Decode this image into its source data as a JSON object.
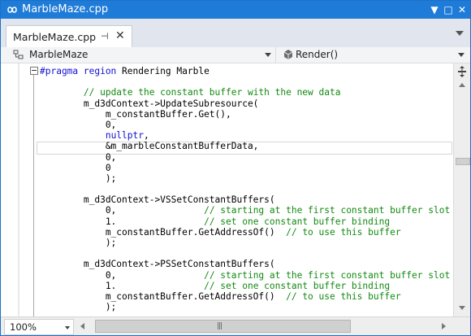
{
  "window": {
    "title": "MarbleMaze.cpp",
    "title_icon": "infinity-icon",
    "accent_color": "#1f7bd8"
  },
  "titlebar_buttons": [
    {
      "name": "dropdown-icon",
      "glyph": "▼"
    },
    {
      "name": "maximize-icon",
      "glyph": "□"
    },
    {
      "name": "close-icon",
      "glyph": "✕"
    }
  ],
  "tab": {
    "label": "MarbleMaze.cpp",
    "pin_glyph": "⊣",
    "close_glyph": "✕"
  },
  "navbar": {
    "left": {
      "label": "MarbleMaze",
      "icon": "class-icon"
    },
    "right": {
      "label": "Render()",
      "icon": "method-icon"
    }
  },
  "code_lines": [
    [
      {
        "t": "#pragma region",
        "c": "kw"
      },
      {
        "t": " Rendering Marble",
        "c": ""
      }
    ],
    [],
    [
      {
        "t": "        ",
        "c": ""
      },
      {
        "t": "// update the constant buffer with the new data",
        "c": "cm"
      }
    ],
    [
      {
        "t": "        m_d3dContext->UpdateSubresource(",
        "c": ""
      }
    ],
    [
      {
        "t": "            m_constantBuffer.Get(),",
        "c": ""
      }
    ],
    [
      {
        "t": "            0,",
        "c": ""
      }
    ],
    [
      {
        "t": "            ",
        "c": ""
      },
      {
        "t": "nullptr",
        "c": "kw"
      },
      {
        "t": ",",
        "c": ""
      }
    ],
    [
      {
        "t": "            &m_marbleConstantBufferData,",
        "c": ""
      }
    ],
    [
      {
        "t": "            0,",
        "c": ""
      }
    ],
    [
      {
        "t": "            0",
        "c": ""
      }
    ],
    [
      {
        "t": "            );",
        "c": ""
      }
    ],
    [],
    [
      {
        "t": "        m_d3dContext->VSSetConstantBuffers(",
        "c": ""
      }
    ],
    [
      {
        "t": "            0,                ",
        "c": ""
      },
      {
        "t": "// starting at the first constant buffer slot",
        "c": "cm"
      }
    ],
    [
      {
        "t": "            1.                ",
        "c": ""
      },
      {
        "t": "// set one constant buffer binding",
        "c": "cm"
      }
    ],
    [
      {
        "t": "            m_constantBuffer.GetAddressOf()  ",
        "c": ""
      },
      {
        "t": "// to use this buffer",
        "c": "cm"
      }
    ],
    [
      {
        "t": "            );",
        "c": ""
      }
    ],
    [],
    [
      {
        "t": "        m_d3dContext->PSSetConstantBuffers(",
        "c": ""
      }
    ],
    [
      {
        "t": "            0,                ",
        "c": ""
      },
      {
        "t": "// starting at the first constant buffer slot",
        "c": "cm"
      }
    ],
    [
      {
        "t": "            1.                ",
        "c": ""
      },
      {
        "t": "// set one constant buffer binding",
        "c": "cm"
      }
    ],
    [
      {
        "t": "            m_constantBuffer.GetAddressOf()  ",
        "c": ""
      },
      {
        "t": "// to use this buffer",
        "c": "cm"
      }
    ],
    [
      {
        "t": "            );",
        "c": ""
      }
    ]
  ],
  "zoom": {
    "value": "100%"
  },
  "hscroll_grip": "|||"
}
